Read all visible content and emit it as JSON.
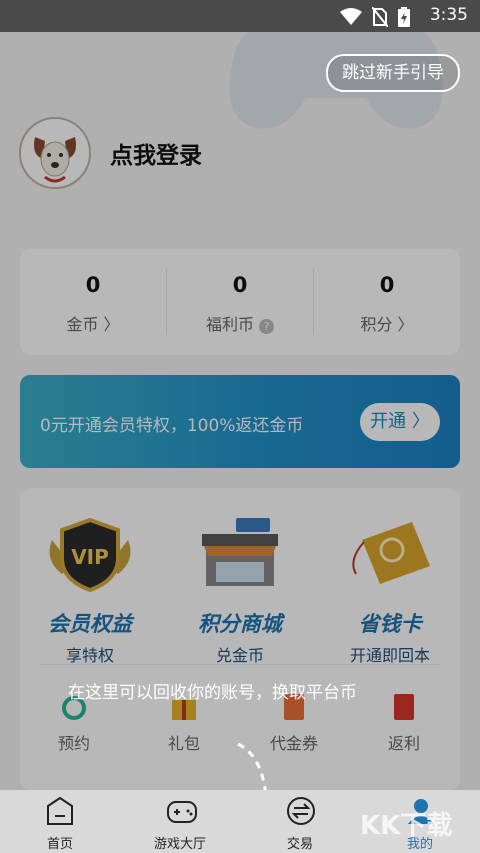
{
  "status": {
    "time": "3:35"
  },
  "guide": {
    "skip_label": "跳过新手引导",
    "tip": "在这里可以回收你的账号，换取平台币"
  },
  "profile": {
    "login_text": "点我登录"
  },
  "coins": [
    {
      "value": "0",
      "label": "金币 〉"
    },
    {
      "value": "0",
      "label": "福利币"
    },
    {
      "value": "0",
      "label": "积分 〉"
    }
  ],
  "vip_banner": {
    "text": "0元开通会员特权，100%返还金币",
    "button": "开通 〉"
  },
  "features": [
    {
      "title": "会员权益",
      "sub": "享特权"
    },
    {
      "title": "积分商城",
      "sub": "兑金币"
    },
    {
      "title": "省钱卡",
      "sub": "开通即回本"
    }
  ],
  "mini": [
    {
      "label": "预约"
    },
    {
      "label": "礼包"
    },
    {
      "label": "代金券"
    },
    {
      "label": "返利"
    }
  ],
  "tabs": [
    {
      "label": "首页"
    },
    {
      "label": "游戏大厅"
    },
    {
      "label": "交易"
    },
    {
      "label": "我的"
    }
  ],
  "watermark": "KK下载",
  "colors": {
    "accent": "#1f74b0",
    "vip_start": "#3ab0c8",
    "vip_end": "#1b82c4",
    "status_bar": "#4a4a4a"
  }
}
